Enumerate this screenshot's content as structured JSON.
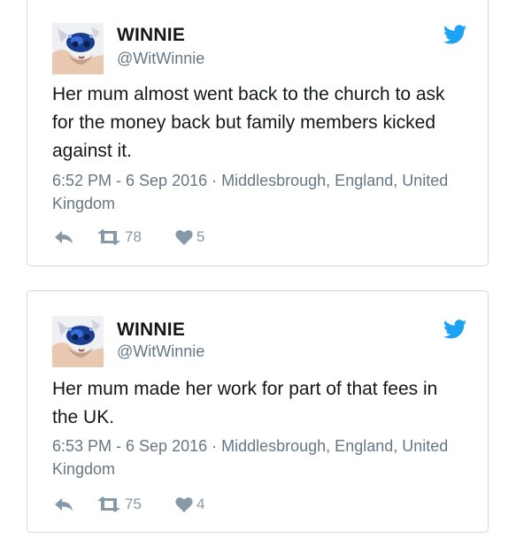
{
  "tweets": [
    {
      "name": "WINNIE",
      "handle": "@WitWinnie",
      "text": "Her mum almost went back to the church to ask for the money back but family members kicked against it.",
      "meta": "6:52 PM - 6 Sep 2016 · Middlesbrough, England, United Kingdom",
      "retweets": "78",
      "likes": "5"
    },
    {
      "name": "WINNIE",
      "handle": "@WitWinnie",
      "text": "Her mum made her work for part of that fees in the UK.",
      "meta": "6:53 PM - 6 Sep 2016 · Middlesbrough, England, United Kingdom",
      "retweets": "75",
      "likes": "4"
    }
  ],
  "icons": {
    "brand": "twitter-bird-icon",
    "reply": "reply-icon",
    "retweet": "retweet-icon",
    "like": "heart-icon"
  },
  "colors": {
    "twitter_blue": "#1da1f2",
    "secondary_text": "#657786",
    "action_icon": "#8899a6",
    "border": "#d5d9dd"
  }
}
